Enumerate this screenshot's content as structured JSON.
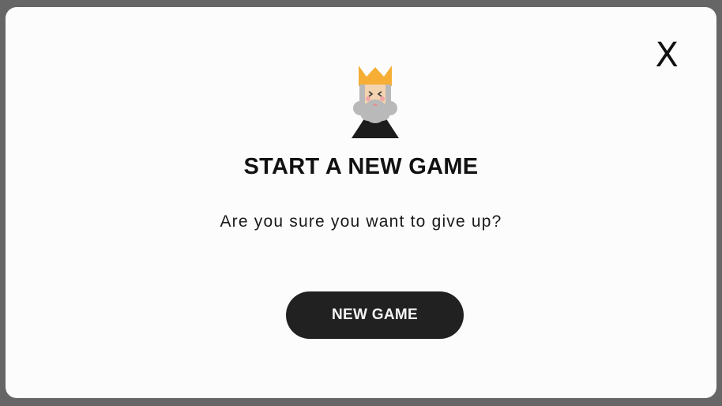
{
  "dialog": {
    "close_label": "X",
    "title": "START A NEW GAME",
    "message": "Are you sure you want to give up?",
    "primary_button": "NEW GAME",
    "avatar_icon": "king-avatar-icon"
  },
  "colors": {
    "backdrop": "#666666",
    "panel": "#fcfcfc",
    "button_bg": "#212121",
    "button_text": "#f5f5f5",
    "crown": "#f6ae35",
    "beard": "#b9b9b9",
    "robe": "#1c1c1c"
  }
}
